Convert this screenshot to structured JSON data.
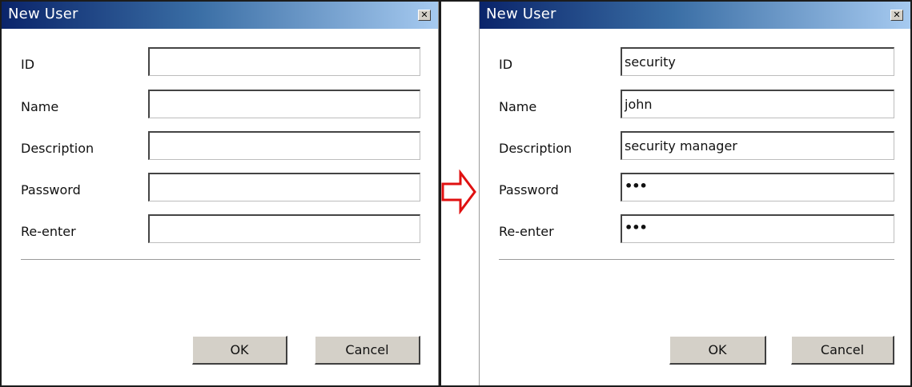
{
  "left_dialog": {
    "title": "New User",
    "close_glyph": "✕",
    "fields": [
      {
        "label": "ID",
        "value": ""
      },
      {
        "label": "Name",
        "value": ""
      },
      {
        "label": "Description",
        "value": ""
      },
      {
        "label": "Password",
        "value": ""
      },
      {
        "label": "Re-enter",
        "value": ""
      }
    ],
    "ok_label": "OK",
    "cancel_label": "Cancel"
  },
  "right_dialog": {
    "title": "New User",
    "close_glyph": "✕",
    "fields": [
      {
        "label": "ID",
        "value": "security"
      },
      {
        "label": "Name",
        "value": "john"
      },
      {
        "label": "Description",
        "value": "security manager"
      },
      {
        "label": "Password",
        "value": "•••"
      },
      {
        "label": "Re-enter",
        "value": "•••"
      }
    ],
    "ok_label": "OK",
    "cancel_label": "Cancel"
  },
  "arrow_icon": "right-arrow",
  "colors": {
    "titlebar_start": "#0a246a",
    "titlebar_end": "#a6caf0",
    "arrow": "#e01010",
    "button_face": "#d4d0c8"
  }
}
